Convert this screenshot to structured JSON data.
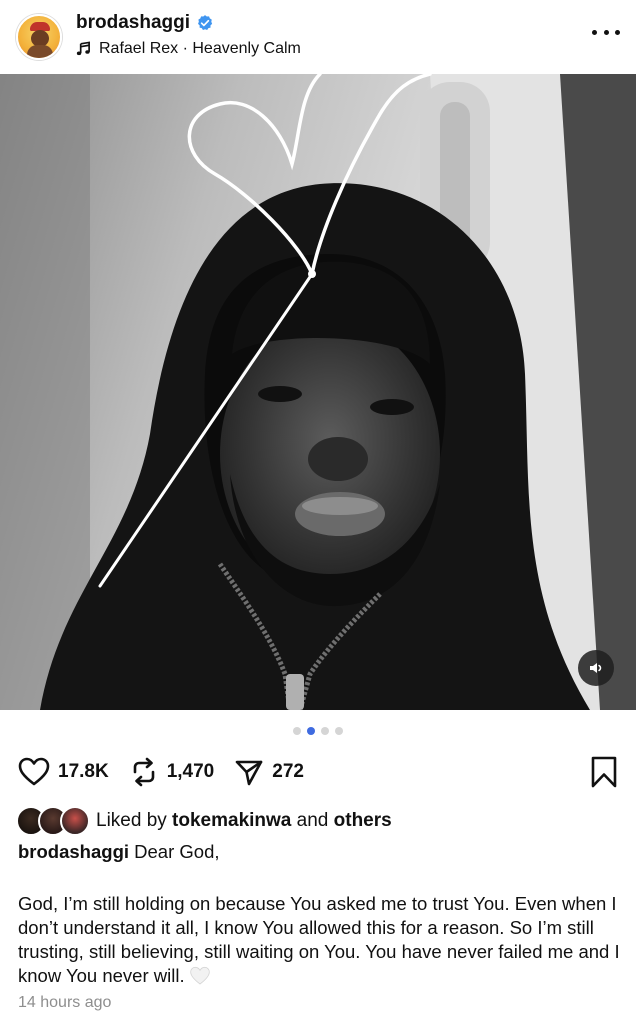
{
  "header": {
    "username": "brodashaggi",
    "music": "Rafael Rex · Heavenly Calm",
    "verified": true
  },
  "photo": {
    "description_icon": "mute-icon",
    "carousel": {
      "count": 4,
      "active_index": 1
    }
  },
  "actions": {
    "likes": "17.8K",
    "reposts": "1,470",
    "shares": "272"
  },
  "liked_by": {
    "prefix": "Liked by ",
    "user": "tokemakinwa",
    "middle": " and ",
    "suffix": "others"
  },
  "caption": {
    "username": "brodashaggi",
    "first_line": "Dear God,",
    "body": "God, I’m still holding on because You asked me to trust You. Even when I don’t understand it all, I know You allowed this for a reason. So I’m still trusting, still believing, still waiting on You. You have never failed me and I know You never will."
  },
  "timestamp": "14 hours ago",
  "colors": {
    "verified": "#3f95f0",
    "carousel_active": "#3f6be0",
    "timestamp": "#8e8e8e"
  }
}
